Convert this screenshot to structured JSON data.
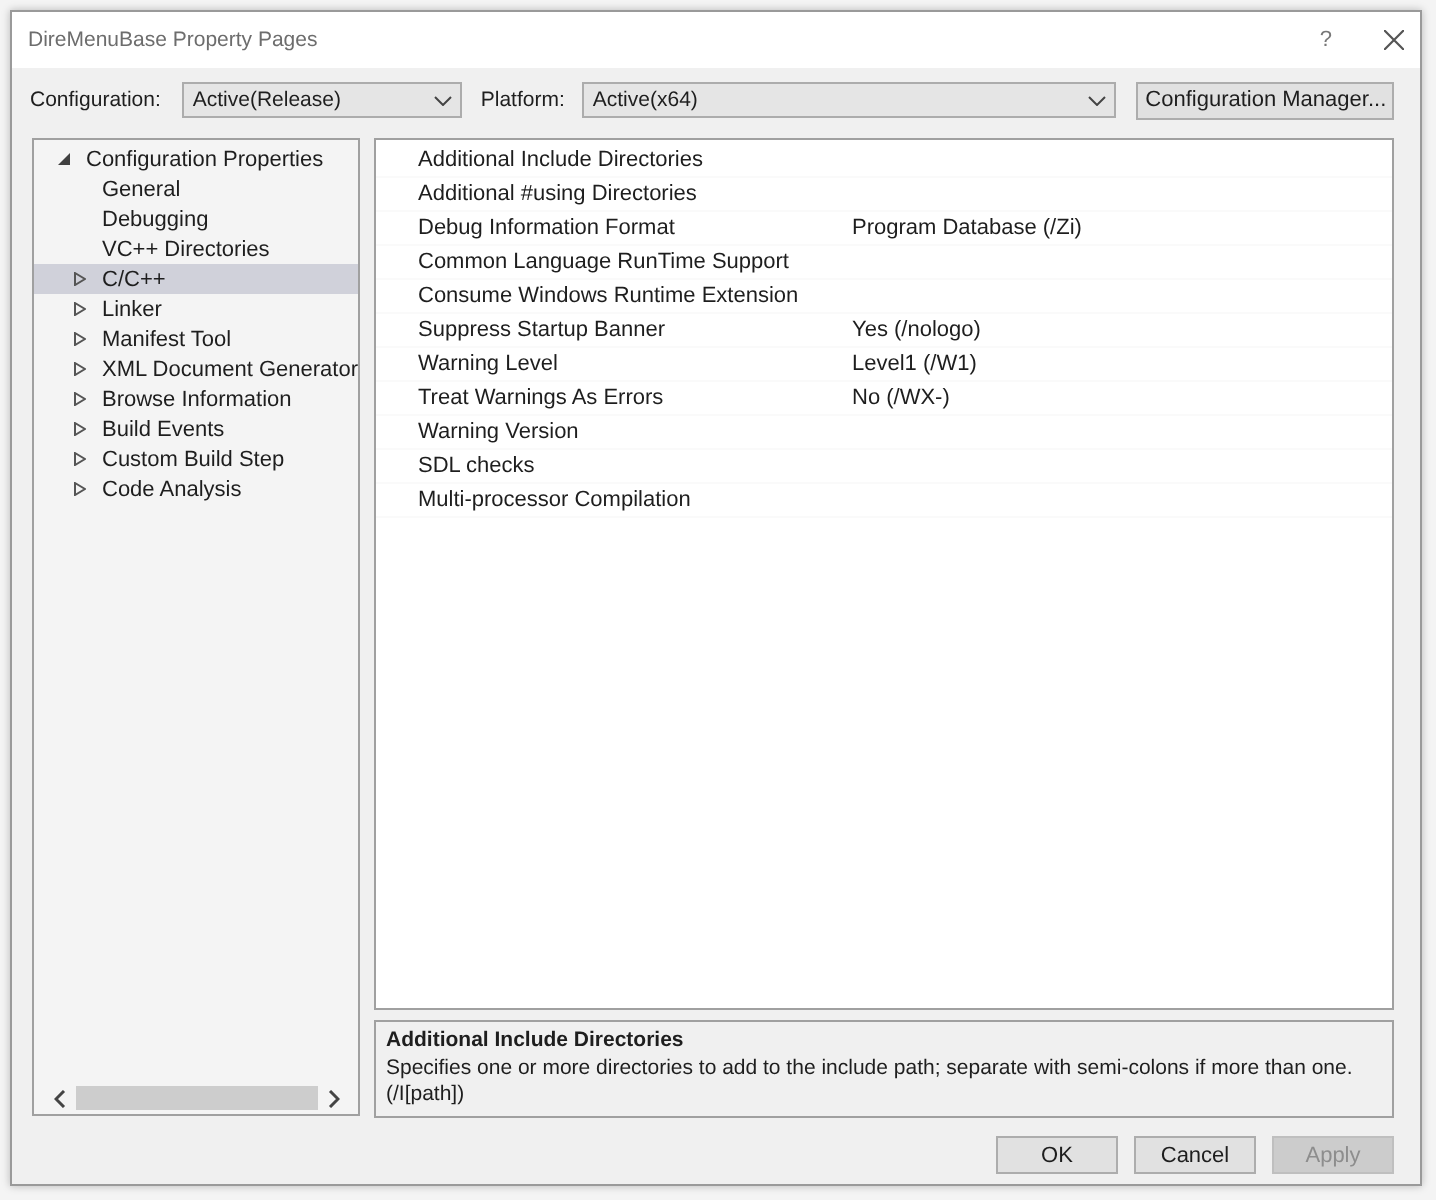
{
  "window": {
    "title": "DireMenuBase Property Pages",
    "help": "?"
  },
  "toolbar": {
    "configuration": {
      "label": "Configuration:",
      "value": "Active(Release)"
    },
    "platform": {
      "label": "Platform:",
      "value": "Active(x64)"
    },
    "manager_button": "Configuration Manager..."
  },
  "tree": {
    "items": [
      {
        "label": "Configuration Properties",
        "kind": "group",
        "expanded": true,
        "selected": false,
        "children": [
          {
            "label": "General",
            "kind": "page",
            "selected": false
          },
          {
            "label": "Debugging",
            "kind": "page",
            "selected": false
          },
          {
            "label": "VC++ Directories",
            "kind": "page",
            "selected": false
          },
          {
            "label": "C/C++",
            "kind": "group",
            "expanded": false,
            "selected": true
          },
          {
            "label": "Linker",
            "kind": "group",
            "expanded": false,
            "selected": false
          },
          {
            "label": "Manifest Tool",
            "kind": "group",
            "expanded": false,
            "selected": false
          },
          {
            "label": "XML Document Generator",
            "kind": "group",
            "expanded": false,
            "selected": false
          },
          {
            "label": "Browse Information",
            "kind": "group",
            "expanded": false,
            "selected": false
          },
          {
            "label": "Build Events",
            "kind": "group",
            "expanded": false,
            "selected": false
          },
          {
            "label": "Custom Build Step",
            "kind": "group",
            "expanded": false,
            "selected": false
          },
          {
            "label": "Code Analysis",
            "kind": "group",
            "expanded": false,
            "selected": false
          }
        ]
      }
    ]
  },
  "properties": [
    {
      "name": "Additional Include Directories"
    },
    {
      "name": "Additional #using Directories"
    },
    {
      "name": "Debug Information Format",
      "value": "Program Database (/Zi)"
    },
    {
      "name": "Common Language RunTime Support"
    },
    {
      "name": "Consume Windows Runtime Extension"
    },
    {
      "name": "Suppress Startup Banner",
      "value": "Yes (/nologo)"
    },
    {
      "name": "Warning Level",
      "value": "Level1 (/W1)"
    },
    {
      "name": "Treat Warnings As Errors",
      "value": "No (/WX-)"
    },
    {
      "name": "Warning Version"
    },
    {
      "name": "SDL checks"
    },
    {
      "name": "Multi-processor Compilation"
    }
  ],
  "description": {
    "title": "Additional Include Directories",
    "text": "Specifies one or more directories to add to the include path; separate with semi-colons if more than one. (/I[path])"
  },
  "buttons": [
    {
      "label": "OK",
      "disabled": false
    },
    {
      "label": "Cancel",
      "disabled": false
    },
    {
      "label": "Apply",
      "disabled": true
    }
  ]
}
